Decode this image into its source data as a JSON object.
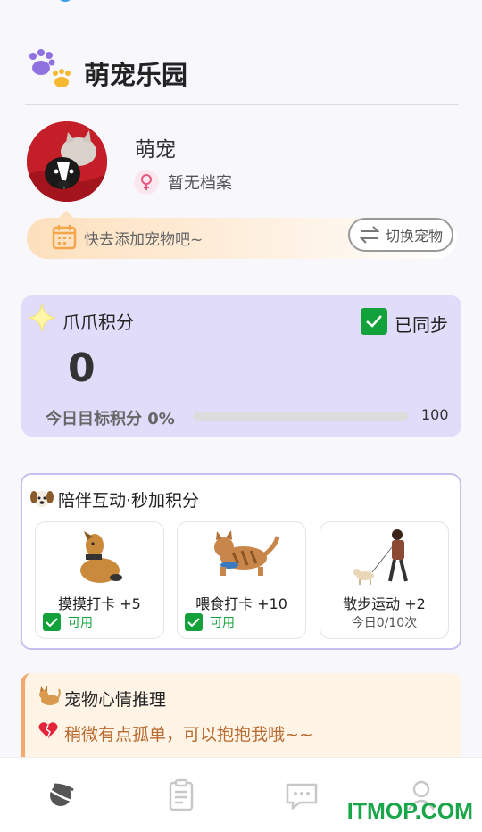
{
  "header": {
    "title": "萌宠乐园",
    "icon": "paw-icon"
  },
  "profile": {
    "name": "萌宠",
    "gender_icon": "female-icon",
    "archive_status": "暂无档案"
  },
  "add_pet": {
    "text": "快去添加宠物吧~",
    "switch_label": "切换宠物"
  },
  "points": {
    "title": "爪爪积分",
    "sync_label": "已同步",
    "value": "0",
    "goal_label": "今日目标积分 0%",
    "goal_max": "100",
    "goal_progress": 0
  },
  "interact": {
    "title": "陪伴互动·秒加积分",
    "tasks": [
      {
        "label": "摸摸打卡 +5",
        "status": "可用"
      },
      {
        "label": "喂食打卡 +10",
        "status": "可用"
      },
      {
        "label": "散步运动 +2",
        "count": "今日0/10次"
      }
    ]
  },
  "mood": {
    "title": "宠物心情推理",
    "text": "稍微有点孤单，可以抱抱我哦~~"
  },
  "tabbar": {
    "items": [
      "home-icon",
      "clipboard-icon",
      "chat-icon",
      "profile-icon"
    ]
  },
  "watermark": "ITMOP.COM",
  "colors": {
    "accent_purple": "#e0dcfa",
    "green": "#12a13a",
    "mood_text": "#b86a2f",
    "mood_bg": "#fff4e6"
  }
}
